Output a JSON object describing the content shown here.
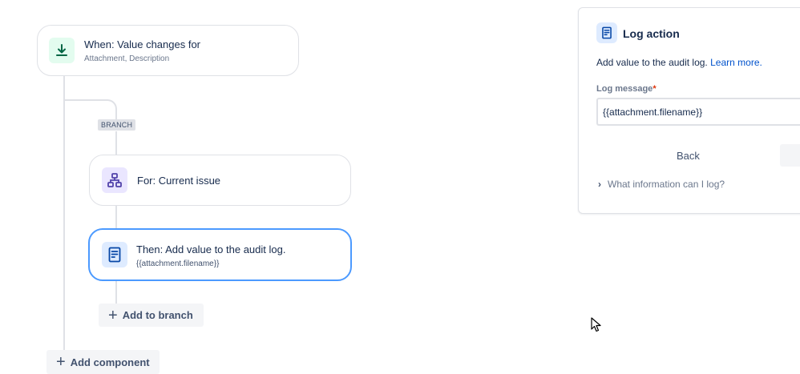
{
  "trigger": {
    "title": "When: Value changes for",
    "subtitle": "Attachment, Description",
    "icon": "download-arrow-icon"
  },
  "branch": {
    "badge": "BRANCH",
    "for_card": {
      "title": "For: Current issue",
      "icon": "hierarchy-icon"
    },
    "action_card": {
      "title": "Then: Add value to the audit log.",
      "subtitle": "{{attachment.filename}}",
      "icon": "document-icon"
    },
    "add_to_branch": "Add to branch"
  },
  "add_component": "Add component",
  "panel": {
    "title": "Log action",
    "icon": "document-icon",
    "description": "Add value to the audit log.",
    "learn_more": "Learn more.",
    "field_label": "Log message",
    "required_marker": "*",
    "field_value": "{{attachment.filename}}",
    "back_label": "Back",
    "expander_label": "What information can I log?"
  },
  "colors": {
    "accent": "#0052cc",
    "selected_border": "#4c9aff",
    "trigger_icon_bg": "#e3fcef",
    "trigger_icon": "#006644",
    "branch_icon_bg": "#eae6ff",
    "branch_icon": "#5243aa",
    "action_icon_bg": "#deebff",
    "action_icon": "#0747a6"
  }
}
